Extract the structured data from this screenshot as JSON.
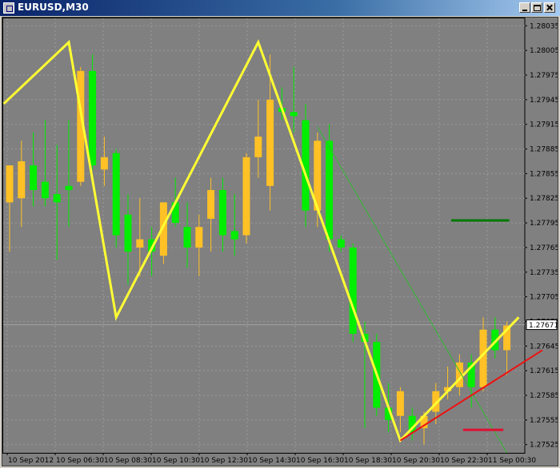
{
  "window": {
    "title": "EURUSD,M30",
    "icon": "chart-window-icon",
    "buttons": [
      "minimize-icon",
      "maximize-icon",
      "close-icon"
    ]
  },
  "colors": {
    "background": "#808080",
    "grid": "#9a9a9a",
    "bull": "#ffc125",
    "bear": "#00ee00",
    "zigzag": "#ffff33",
    "trend_green": "#33bb33",
    "trend_red": "#ee1111",
    "level_green": "#007700",
    "level_red": "#dd1133",
    "current_price_line": "#a0a0a0"
  },
  "chart_data": {
    "type": "candlestick",
    "symbol": "EURUSD",
    "timeframe": "M30",
    "current_price": "1.27671",
    "y_ticks": [
      "1.28035",
      "1.28005",
      "1.27975",
      "1.27945",
      "1.27915",
      "1.27885",
      "1.27855",
      "1.27825",
      "1.27795",
      "1.27765",
      "1.27735",
      "1.27705",
      "1.27675",
      "1.27645",
      "1.27615",
      "1.27585",
      "1.27555",
      "1.27525"
    ],
    "ylim": [
      1.27515,
      1.28045
    ],
    "x_ticks": [
      "10 Sep 2012",
      "10 Sep 06:30",
      "10 Sep 08:30",
      "10 Sep 10:30",
      "10 Sep 12:30",
      "10 Sep 14:30",
      "10 Sep 16:30",
      "10 Sep 18:30",
      "10 Sep 20:30",
      "10 Sep 22:30",
      "11 Sep 00:30"
    ],
    "candles": [
      {
        "o": 1.2782,
        "h": 1.2786,
        "l": 1.2776,
        "c": 1.27865
      },
      {
        "o": 1.27825,
        "h": 1.27895,
        "l": 1.2779,
        "c": 1.2787
      },
      {
        "o": 1.27865,
        "h": 1.27905,
        "l": 1.27815,
        "c": 1.27835
      },
      {
        "o": 1.27845,
        "h": 1.2792,
        "l": 1.27815,
        "c": 1.27825
      },
      {
        "o": 1.2783,
        "h": 1.2789,
        "l": 1.2775,
        "c": 1.2782
      },
      {
        "o": 1.2784,
        "h": 1.2792,
        "l": 1.2779,
        "c": 1.27835
      },
      {
        "o": 1.27845,
        "h": 1.27985,
        "l": 1.2784,
        "c": 1.2798
      },
      {
        "o": 1.2798,
        "h": 1.28,
        "l": 1.2786,
        "c": 1.27865
      },
      {
        "o": 1.2786,
        "h": 1.279,
        "l": 1.2784,
        "c": 1.27875
      },
      {
        "o": 1.2788,
        "h": 1.27885,
        "l": 1.27765,
        "c": 1.2778
      },
      {
        "o": 1.27805,
        "h": 1.2783,
        "l": 1.2772,
        "c": 1.2776
      },
      {
        "o": 1.27765,
        "h": 1.27825,
        "l": 1.2773,
        "c": 1.27775
      },
      {
        "o": 1.27775,
        "h": 1.2779,
        "l": 1.2773,
        "c": 1.2776
      },
      {
        "o": 1.27755,
        "h": 1.2782,
        "l": 1.27745,
        "c": 1.2782
      },
      {
        "o": 1.2782,
        "h": 1.2785,
        "l": 1.2779,
        "c": 1.27795
      },
      {
        "o": 1.2779,
        "h": 1.2782,
        "l": 1.2774,
        "c": 1.27765
      },
      {
        "o": 1.27765,
        "h": 1.27805,
        "l": 1.2773,
        "c": 1.2779
      },
      {
        "o": 1.278,
        "h": 1.2785,
        "l": 1.2776,
        "c": 1.27835
      },
      {
        "o": 1.27835,
        "h": 1.2785,
        "l": 1.2776,
        "c": 1.2778
      },
      {
        "o": 1.27785,
        "h": 1.2783,
        "l": 1.27755,
        "c": 1.27775
      },
      {
        "o": 1.2778,
        "h": 1.2788,
        "l": 1.2777,
        "c": 1.27875
      },
      {
        "o": 1.27875,
        "h": 1.27945,
        "l": 1.2785,
        "c": 1.279
      },
      {
        "o": 1.2784,
        "h": 1.28,
        "l": 1.2781,
        "c": 1.27945
      },
      {
        "o": 1.27935,
        "h": 1.2796,
        "l": 1.2792,
        "c": 1.2793
      },
      {
        "o": 1.2793,
        "h": 1.27985,
        "l": 1.27905,
        "c": 1.27925
      },
      {
        "o": 1.2792,
        "h": 1.2794,
        "l": 1.2779,
        "c": 1.2781
      },
      {
        "o": 1.2781,
        "h": 1.27905,
        "l": 1.2779,
        "c": 1.27895
      },
      {
        "o": 1.27895,
        "h": 1.27915,
        "l": 1.2776,
        "c": 1.27775
      },
      {
        "o": 1.27775,
        "h": 1.2778,
        "l": 1.2776,
        "c": 1.27765
      },
      {
        "o": 1.27765,
        "h": 1.2777,
        "l": 1.2765,
        "c": 1.2766
      },
      {
        "o": 1.2766,
        "h": 1.27675,
        "l": 1.27545,
        "c": 1.2765
      },
      {
        "o": 1.2765,
        "h": 1.2766,
        "l": 1.2756,
        "c": 1.2757
      },
      {
        "o": 1.2757,
        "h": 1.276,
        "l": 1.2754,
        "c": 1.27555
      },
      {
        "o": 1.2756,
        "h": 1.27595,
        "l": 1.2754,
        "c": 1.2759
      },
      {
        "o": 1.2756,
        "h": 1.2757,
        "l": 1.2753,
        "c": 1.2754
      },
      {
        "o": 1.27545,
        "h": 1.27565,
        "l": 1.27525,
        "c": 1.2756
      },
      {
        "o": 1.27565,
        "h": 1.276,
        "l": 1.2755,
        "c": 1.2759
      },
      {
        "o": 1.2759,
        "h": 1.2762,
        "l": 1.2758,
        "c": 1.27595
      },
      {
        "o": 1.27595,
        "h": 1.27635,
        "l": 1.27585,
        "c": 1.27625
      },
      {
        "o": 1.27625,
        "h": 1.27635,
        "l": 1.2757,
        "c": 1.27595
      },
      {
        "o": 1.27595,
        "h": 1.2768,
        "l": 1.2759,
        "c": 1.27665
      },
      {
        "o": 1.27665,
        "h": 1.2768,
        "l": 1.2763,
        "c": 1.2764
      },
      {
        "o": 1.2764,
        "h": 1.27675,
        "l": 1.2761,
        "c": 1.2767
      }
    ],
    "zigzag": [
      {
        "i": -0.5,
        "p": 1.2794
      },
      {
        "i": 5,
        "p": 1.28015
      },
      {
        "i": 9,
        "p": 1.2768
      },
      {
        "i": 21,
        "p": 1.28015
      },
      {
        "i": 33,
        "p": 1.2753
      },
      {
        "i": 43,
        "p": 1.2768
      }
    ],
    "trendlines": [
      {
        "color_key": "trend_green",
        "width": 1,
        "from": {
          "i": 26,
          "p": 1.27912
        },
        "to": {
          "i": 42,
          "p": 1.27515
        }
      },
      {
        "color_key": "trend_red",
        "width": 2,
        "from": {
          "i": 33,
          "p": 1.2753
        },
        "to": {
          "i": 45,
          "p": 1.2764
        }
      }
    ],
    "levels": [
      {
        "color_key": "level_green",
        "price": 1.27798,
        "from_i": 37.3,
        "to_i": 42.2
      },
      {
        "color_key": "level_red",
        "price": 1.27543,
        "from_i": 38.3,
        "to_i": 41.7
      }
    ]
  }
}
